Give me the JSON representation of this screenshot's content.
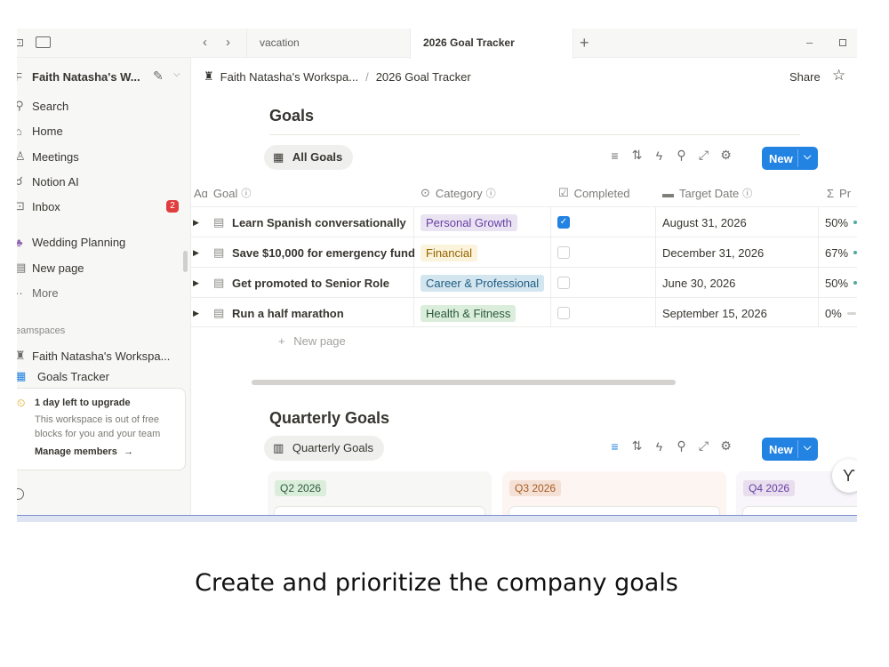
{
  "sidebar": {
    "workspace_initial": "F",
    "workspace_name": "Faith Natasha's W...",
    "items": [
      {
        "label": "Search"
      },
      {
        "label": "Home"
      },
      {
        "label": "Meetings"
      },
      {
        "label": "Notion AI"
      },
      {
        "label": "Inbox",
        "badge": "2"
      },
      {
        "label": "Wedding Planning"
      },
      {
        "label": "New page"
      },
      {
        "label": "More"
      }
    ],
    "section_label": "eamspaces",
    "teamspace_items": [
      {
        "label": "Faith Natasha's Workspa..."
      },
      {
        "label": "Goals Tracker"
      }
    ],
    "upgrade": {
      "title": "1 day left to upgrade",
      "description": "This workspace is out of free blocks for you and your team",
      "link": "Manage members"
    }
  },
  "tabs": [
    {
      "label": "vacation"
    },
    {
      "label": "2026 Goal Tracker"
    }
  ],
  "breadcrumb": {
    "workspace": "Faith Natasha's Workspa...",
    "separator": "/",
    "page": "2026 Goal Tracker",
    "share": "Share"
  },
  "goals_section": {
    "title": "Goals",
    "view": "All Goals",
    "new_button": "New",
    "columns": [
      "Goal",
      "Category",
      "Completed",
      "Target Date",
      "Pr"
    ],
    "rows": [
      {
        "goal": "Learn Spanish conversationally",
        "category": "Personal Growth",
        "completed": true,
        "target": "August 31, 2026",
        "progress": "50%"
      },
      {
        "goal": "Save $10,000 for emergency fund",
        "category": "Financial",
        "completed": false,
        "target": "December 31, 2026",
        "progress": "67%"
      },
      {
        "goal": "Get promoted to Senior Role",
        "category": "Career & Professional",
        "completed": false,
        "target": "June 30, 2026",
        "progress": "50%"
      },
      {
        "goal": "Run a half marathon",
        "category": "Health & Fitness",
        "completed": false,
        "target": "September 15, 2026",
        "progress": "0%"
      }
    ],
    "new_page": "New page"
  },
  "quarterly_section": {
    "title": "Quarterly Goals",
    "view": "Quarterly Goals",
    "new_button": "New",
    "groups": [
      "Q2 2026",
      "Q3 2026",
      "Q4 2026"
    ]
  },
  "caption": "Create and prioritize the company goals",
  "colors": {
    "accent": "#2383e2",
    "personal_growth": "#eae4f2",
    "financial": "#fbf3db",
    "career": "#d3e5ef",
    "health": "#dbeddb"
  }
}
